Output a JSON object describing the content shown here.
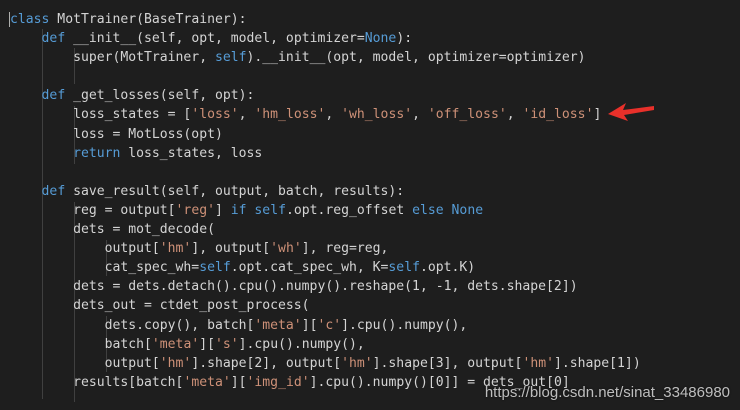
{
  "editor": {
    "language": "python",
    "theme_colors": {
      "background": "#1e1e1e",
      "keyword": "#569cd6",
      "string": "#ce9178",
      "text": "#d4d4d4",
      "annotation_arrow": "#e8302a"
    },
    "lines": [
      [
        [
          "kw",
          "class"
        ],
        [
          "p",
          " MotTrainer(BaseTrainer):"
        ]
      ],
      [
        [
          "p",
          "    "
        ],
        [
          "kw",
          "def"
        ],
        [
          "p",
          " __init__(self, opt, model, optimizer="
        ],
        [
          "kw",
          "None"
        ],
        [
          "p",
          "):"
        ]
      ],
      [
        [
          "p",
          "        super(MotTrainer, "
        ],
        [
          "kw",
          "self"
        ],
        [
          "p",
          ").__init__(opt, model, optimizer=optimizer)"
        ]
      ],
      [
        [
          "p",
          ""
        ]
      ],
      [
        [
          "p",
          "    "
        ],
        [
          "kw",
          "def"
        ],
        [
          "p",
          " _get_losses(self, opt):"
        ]
      ],
      [
        [
          "p",
          "        loss_states = ["
        ],
        [
          "str",
          "'loss'"
        ],
        [
          "p",
          ", "
        ],
        [
          "str",
          "'hm_loss'"
        ],
        [
          "p",
          ", "
        ],
        [
          "str",
          "'wh_loss'"
        ],
        [
          "p",
          ", "
        ],
        [
          "str",
          "'off_loss'"
        ],
        [
          "p",
          ", "
        ],
        [
          "str",
          "'id_loss'"
        ],
        [
          "p",
          "]"
        ]
      ],
      [
        [
          "p",
          "        loss = MotLoss(opt)"
        ]
      ],
      [
        [
          "p",
          "        "
        ],
        [
          "kw",
          "return"
        ],
        [
          "p",
          " loss_states, loss"
        ]
      ],
      [
        [
          "p",
          ""
        ]
      ],
      [
        [
          "p",
          "    "
        ],
        [
          "kw",
          "def"
        ],
        [
          "p",
          " save_result(self, output, batch, results):"
        ]
      ],
      [
        [
          "p",
          "        reg = output["
        ],
        [
          "str",
          "'reg'"
        ],
        [
          "p",
          "] "
        ],
        [
          "kw",
          "if"
        ],
        [
          "p",
          " "
        ],
        [
          "kw",
          "self"
        ],
        [
          "p",
          ".opt.reg_offset "
        ],
        [
          "kw",
          "else"
        ],
        [
          "p",
          " "
        ],
        [
          "kw",
          "None"
        ]
      ],
      [
        [
          "p",
          "        dets = mot_decode("
        ]
      ],
      [
        [
          "p",
          "            output["
        ],
        [
          "str",
          "'hm'"
        ],
        [
          "p",
          "], output["
        ],
        [
          "str",
          "'wh'"
        ],
        [
          "p",
          "], reg=reg,"
        ]
      ],
      [
        [
          "p",
          "            cat_spec_wh="
        ],
        [
          "kw",
          "self"
        ],
        [
          "p",
          ".opt.cat_spec_wh, K="
        ],
        [
          "kw",
          "self"
        ],
        [
          "p",
          ".opt.K)"
        ]
      ],
      [
        [
          "p",
          "        dets = dets.detach().cpu().numpy().reshape(1, -1, dets.shape[2])"
        ]
      ],
      [
        [
          "p",
          "        dets_out = ctdet_post_process("
        ]
      ],
      [
        [
          "p",
          "            dets.copy(), batch["
        ],
        [
          "str",
          "'meta'"
        ],
        [
          "p",
          "]["
        ],
        [
          "str",
          "'c'"
        ],
        [
          "p",
          "].cpu().numpy(),"
        ]
      ],
      [
        [
          "p",
          "            batch["
        ],
        [
          "str",
          "'meta'"
        ],
        [
          "p",
          "]["
        ],
        [
          "str",
          "'s'"
        ],
        [
          "p",
          "].cpu().numpy(),"
        ]
      ],
      [
        [
          "p",
          "            output["
        ],
        [
          "str",
          "'hm'"
        ],
        [
          "p",
          "].shape[2], output["
        ],
        [
          "str",
          "'hm'"
        ],
        [
          "p",
          "].shape[3], output["
        ],
        [
          "str",
          "'hm'"
        ],
        [
          "p",
          "].shape[1])"
        ]
      ],
      [
        [
          "p",
          "        results[batch["
        ],
        [
          "str",
          "'meta'"
        ],
        [
          "p",
          "]["
        ],
        [
          "str",
          "'img_id'"
        ],
        [
          "p",
          "].cpu().numpy()[0]] = dets_out[0]"
        ]
      ]
    ]
  },
  "annotation": {
    "arrow_icon": "red-arrow-pointing-left"
  },
  "watermark": {
    "text": "https://blog.csdn.net/sinat_33486980"
  }
}
